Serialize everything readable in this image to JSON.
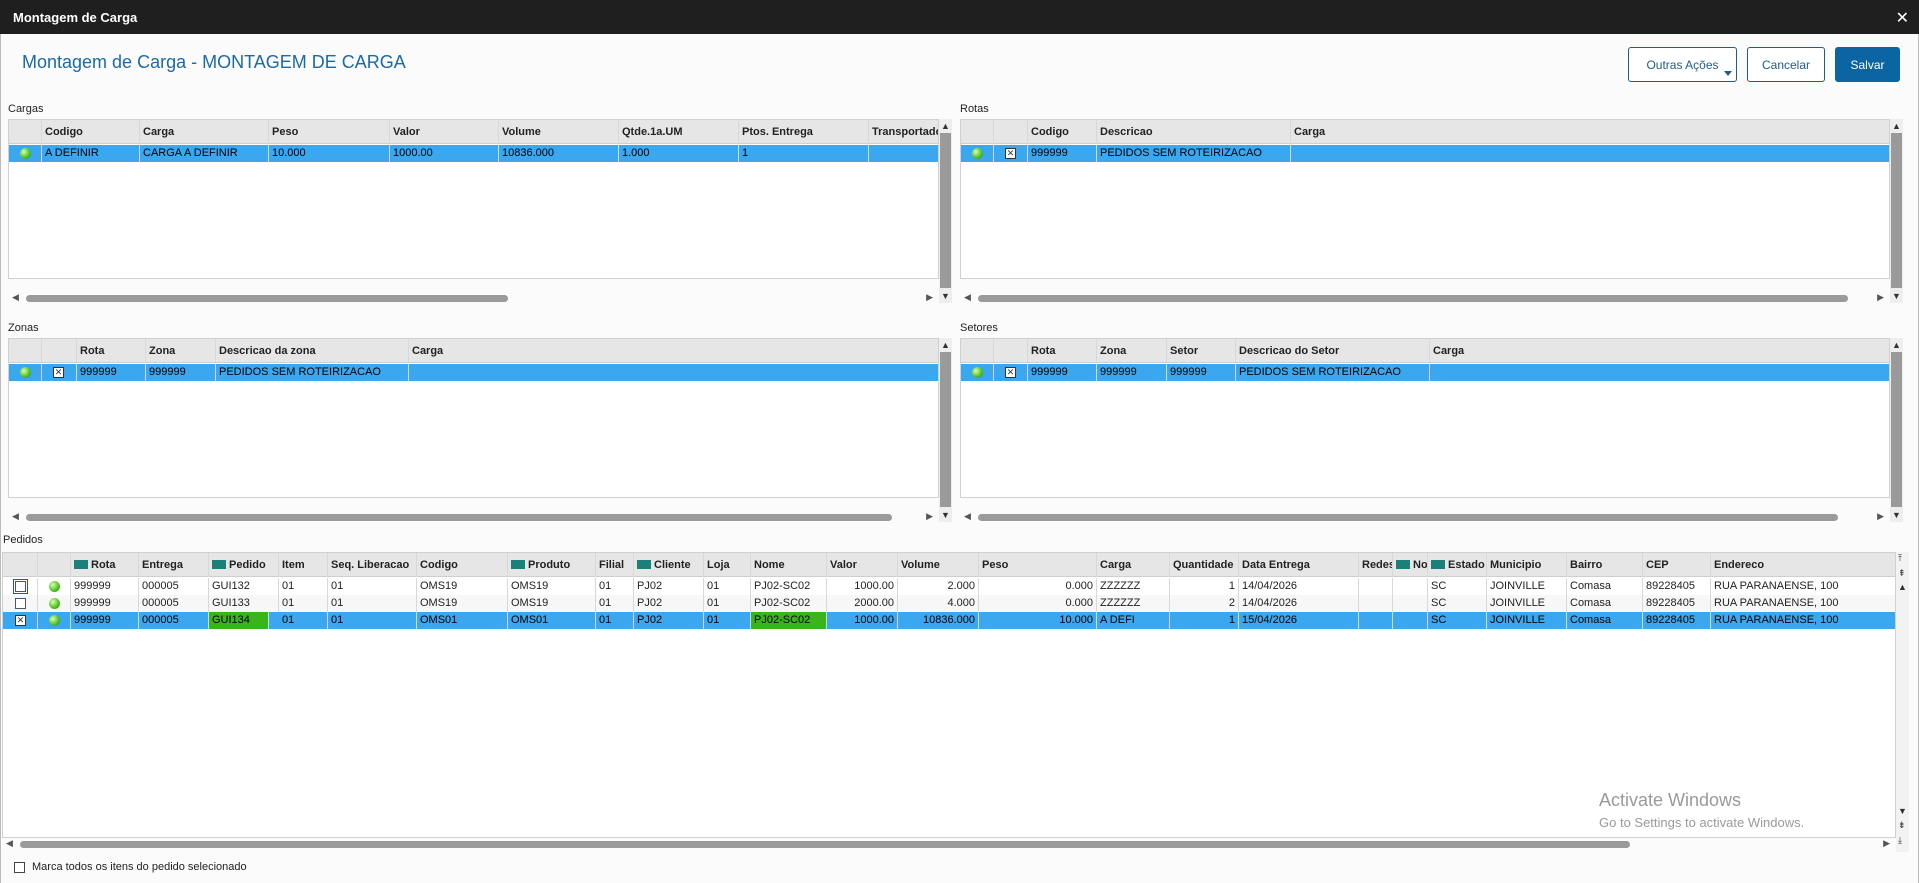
{
  "window": {
    "title": "Montagem de Carga",
    "close": "✕"
  },
  "page": {
    "title": "Montagem de Carga - MONTAGEM DE CARGA"
  },
  "toolbar": {
    "other_actions": "Outras Ações",
    "cancel": "Cancelar",
    "save": "Salvar"
  },
  "cargas": {
    "label": "Cargas",
    "columns": [
      "Codigo",
      "Carga",
      "Peso",
      "Valor",
      "Volume",
      "Qtde.1a.UM",
      "Ptos. Entrega",
      "Transportadora"
    ],
    "rows": [
      [
        "A DEFINIR",
        "CARGA A DEFINIR",
        "10.000",
        "1000.00",
        "10836.000",
        "1.000",
        "1",
        ""
      ]
    ]
  },
  "rotas": {
    "label": "Rotas",
    "columns": [
      "Codigo",
      "Descricao",
      "Carga"
    ],
    "rows": [
      [
        "999999",
        "PEDIDOS SEM ROTEIRIZACAO",
        ""
      ]
    ]
  },
  "zonas": {
    "label": "Zonas",
    "columns": [
      "Rota",
      "Zona",
      "Descricao da zona",
      "Carga"
    ],
    "rows": [
      [
        "999999",
        "999999",
        "PEDIDOS SEM ROTEIRIZACAO",
        ""
      ]
    ]
  },
  "setores": {
    "label": "Setores",
    "columns": [
      "Rota",
      "Zona",
      "Setor",
      "Descricao do Setor",
      "Carga"
    ],
    "rows": [
      [
        "999999",
        "999999",
        "999999",
        "PEDIDOS SEM ROTEIRIZACAO",
        ""
      ]
    ]
  },
  "pedidos": {
    "label": "Pedidos",
    "columns": [
      "Rota",
      "Entrega",
      "Pedido",
      "Item",
      "Seq. Liberacao",
      "Codigo",
      "Produto",
      "Filial",
      "Cliente",
      "Loja",
      "Nome",
      "Valor",
      "Volume",
      "Peso",
      "Carga",
      "Quantidade",
      "Data Entrega",
      "Redes",
      "No",
      "Estado",
      "Municipio",
      "Bairro",
      "CEP",
      "Endereco"
    ],
    "rows": [
      [
        "999999",
        "000005",
        "GUI132",
        "01",
        "01",
        "OMS19",
        "OMS19",
        "01",
        "PJ02",
        "01",
        "PJ02-SC02",
        "1000.00",
        "2.000",
        "0.000",
        "ZZZZZZ",
        "1",
        "14/04/2026",
        "",
        "",
        "SC",
        "JOINVILLE",
        "Comasa",
        "89228405",
        "RUA PARANAENSE, 100"
      ],
      [
        "999999",
        "000005",
        "GUI133",
        "01",
        "01",
        "OMS19",
        "OMS19",
        "01",
        "PJ02",
        "01",
        "PJ02-SC02",
        "2000.00",
        "4.000",
        "0.000",
        "ZZZZZZ",
        "2",
        "14/04/2026",
        "",
        "",
        "SC",
        "JOINVILLE",
        "Comasa",
        "89228405",
        "RUA PARANAENSE, 100"
      ],
      [
        "999999",
        "000005",
        "GUI134",
        "01",
        "01",
        "OMS01",
        "OMS01",
        "01",
        "PJ02",
        "01",
        "PJ02-SC02",
        "1000.00",
        "10836.000",
        "10.000",
        "A DEFI",
        "1",
        "15/04/2026",
        "",
        "",
        "SC",
        "JOINVILLE",
        "Comasa",
        "89228405",
        "RUA PARANAENSE, 100"
      ]
    ]
  },
  "footer": {
    "mark_all_label": "Marca todos os itens do pedido selecionado"
  },
  "watermark": {
    "line1": "Activate Windows",
    "line2": "Go to Settings to activate Windows."
  },
  "icons": {
    "status": "green-status-icon",
    "route_marker": "x-box-icon"
  },
  "colors": {
    "selection": "#3aa7ee",
    "accent": "#0b65a3",
    "highlight": "#3bb31a",
    "header_marker": "#1c7f7a"
  }
}
